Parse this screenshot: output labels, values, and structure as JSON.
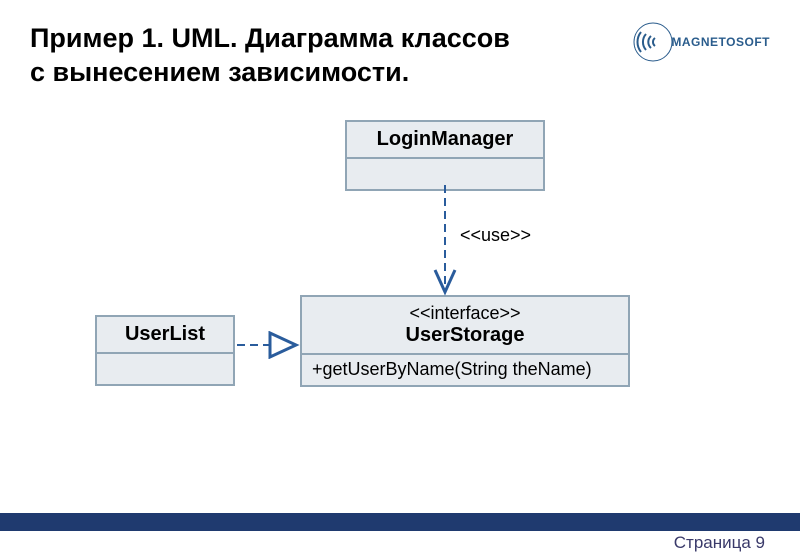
{
  "title_line1": "Пример 1. UML. Диаграмма классов",
  "title_line2": "с вынесением зависимости.",
  "logo_text": "MAGNETOSOFT",
  "diagram": {
    "login_manager": {
      "name": "LoginManager"
    },
    "userlist": {
      "name": "UserList"
    },
    "userstorage": {
      "stereotype": "<<interface>>",
      "name": "UserStorage",
      "method": "+getUserByName(String theName)"
    },
    "use_label": "<<use>>"
  },
  "page_label": "Страница 9"
}
